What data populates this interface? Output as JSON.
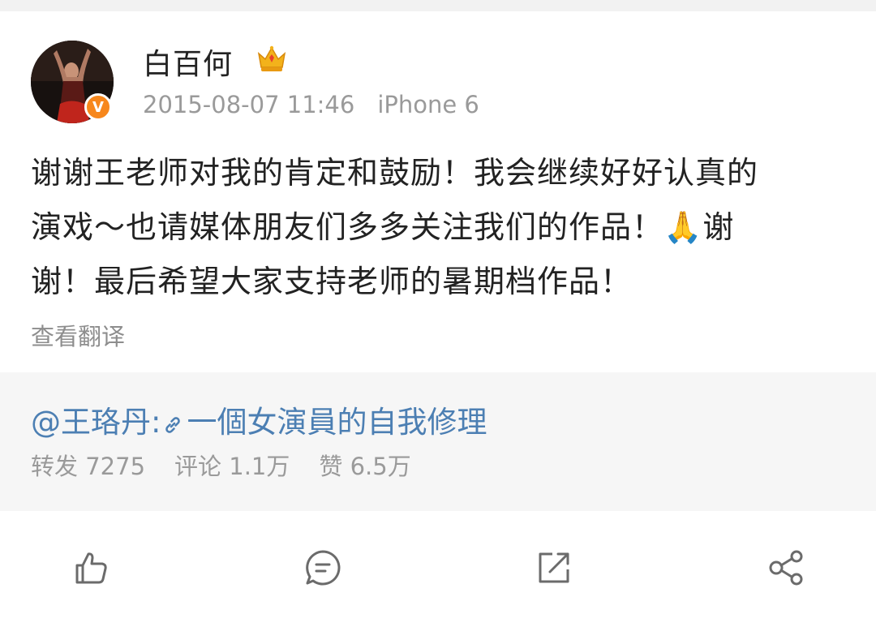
{
  "post": {
    "author": "白百何",
    "date": "2015-08-07 11:46",
    "device": "iPhone 6",
    "content_line1": "谢谢王老师对我的肯定和鼓励！我会继续好好认真的",
    "content_line2a": "演戏～也请媒体朋友们多多关注我们的作品！",
    "content_emoji": "🙏",
    "content_line2b": "谢",
    "content_line3": "谢！最后希望大家支持老师的暑期档作品！",
    "translate_label": "查看翻译"
  },
  "repost": {
    "mention": "@王珞丹:",
    "link_text": "一個女演員的自我修理",
    "stats": {
      "repost_label": "转发 7275",
      "comment_label": "评论 1.1万",
      "like_label": "赞 6.5万"
    }
  },
  "badges": {
    "verify_mark": "V"
  },
  "colors": {
    "link": "#4c7fb3",
    "verify": "#f7871c",
    "icon": "#6b6b6b"
  },
  "icons": [
    "like-icon",
    "comment-icon",
    "repost-icon",
    "share-icon",
    "link-icon",
    "crown-icon"
  ]
}
